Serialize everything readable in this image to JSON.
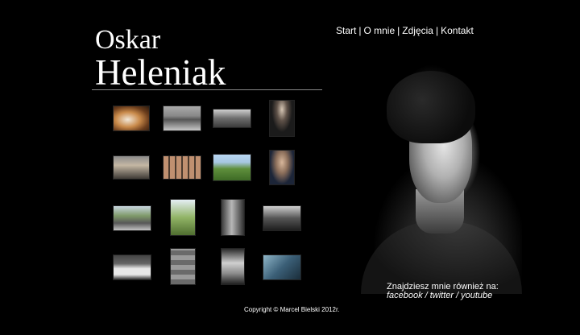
{
  "header": {
    "first_name": "Oskar",
    "last_name": "Heleniak"
  },
  "nav": {
    "items": [
      {
        "label": "Start"
      },
      {
        "label": "O mnie"
      },
      {
        "label": "Zdjęcia"
      },
      {
        "label": "Kontakt"
      }
    ],
    "separator": "|"
  },
  "gallery": {
    "thumbnails": [
      {
        "subject": "beagle dog"
      },
      {
        "subject": "skateboarder"
      },
      {
        "subject": "street with bench"
      },
      {
        "subject": "person in hoodie"
      },
      {
        "subject": "people on street"
      },
      {
        "subject": "grid of photos"
      },
      {
        "subject": "green landscape"
      },
      {
        "subject": "young man portrait"
      },
      {
        "subject": "road with car"
      },
      {
        "subject": "tower among trees"
      },
      {
        "subject": "narrow alley"
      },
      {
        "subject": "building with trees"
      },
      {
        "subject": "station sign"
      },
      {
        "subject": "building facade"
      },
      {
        "subject": "statue on steps"
      },
      {
        "subject": "person jumping"
      }
    ]
  },
  "social": {
    "intro": "Znajdziesz mnie również na:",
    "links": [
      {
        "label": "facebook"
      },
      {
        "label": "twitter"
      },
      {
        "label": "youtube"
      }
    ],
    "separator": "/"
  },
  "footer": {
    "copyright": "Copyright © Marcel Bielski 2012r."
  }
}
